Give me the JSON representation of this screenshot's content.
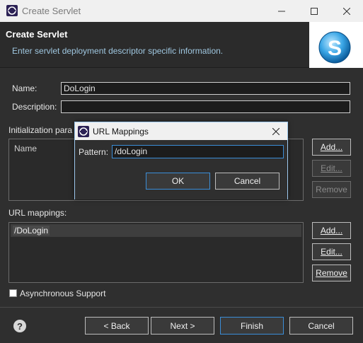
{
  "window": {
    "title": "Create Servlet",
    "controls": {
      "minimize": "—",
      "maximize": "☐",
      "close": "✕"
    }
  },
  "banner": {
    "title": "Create Servlet",
    "description": "Enter servlet deployment descriptor specific information.",
    "logo_letter": "S"
  },
  "form": {
    "name_label": "Name:",
    "name_value": "DoLogin",
    "description_label": "Description:",
    "description_value": "",
    "init_params_label": "Initialization para",
    "init_params_column": "Name",
    "init_buttons": {
      "add": "Add...",
      "edit": "Edit...",
      "remove": "Remove"
    },
    "url_mappings_label": "URL mappings:",
    "url_mappings": [
      "/DoLogin"
    ],
    "url_buttons": {
      "add": "Add...",
      "edit": "Edit...",
      "remove": "Remove"
    },
    "async_label": "Asynchronous Support",
    "async_checked": false
  },
  "dialog": {
    "title": "URL Mappings",
    "pattern_label": "Pattern:",
    "pattern_value": "/doLogin",
    "ok": "OK",
    "cancel": "Cancel"
  },
  "footer": {
    "help": "?",
    "back": "< Back",
    "next": "Next >",
    "finish": "Finish",
    "cancel": "Cancel"
  },
  "colors": {
    "accent": "#3b8ed8",
    "background": "#2f2f2f",
    "link_text": "#9fc7e0"
  }
}
